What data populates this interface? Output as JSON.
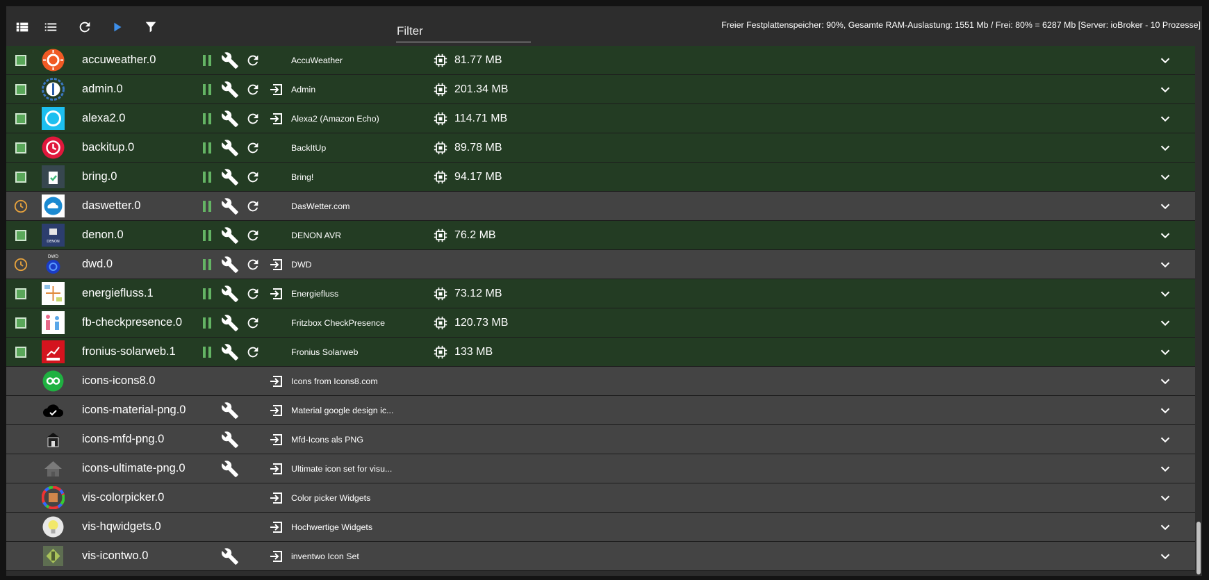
{
  "toolbar": {
    "buttons": [
      {
        "name": "tile-view-button",
        "icon": "view-module-icon"
      },
      {
        "name": "list-view-button",
        "icon": "view-list-icon"
      },
      {
        "name": "refresh-button",
        "icon": "refresh-icon"
      },
      {
        "name": "play-button",
        "icon": "play-icon"
      },
      {
        "name": "filter-button",
        "icon": "filter-icon"
      }
    ],
    "filter_placeholder": "Filter",
    "status": "Freier Festplattenspeicher: 90%, Gesamte RAM-Auslastung: 1551 Mb / Frei: 80% = 6287 Mb [Server: ioBroker - 10 Prozesse]"
  },
  "colors": {
    "running_row": "#233c23",
    "stopped_row": "#444444",
    "status_green": "#5aa75a",
    "schedule_orange": "#e8a33d",
    "action_green": "#64b464",
    "play_blue": "#3d8ee8"
  },
  "instances": [
    {
      "name": "accuweather.0",
      "title": "AccuWeather",
      "ram": "81.77 MB",
      "state": "running",
      "icon": "accuweather-icon",
      "pause": true,
      "settings": true,
      "restart": true,
      "open": false
    },
    {
      "name": "admin.0",
      "title": "Admin",
      "ram": "201.34 MB",
      "state": "running",
      "icon": "admin-icon",
      "pause": true,
      "settings": true,
      "restart": true,
      "open": true
    },
    {
      "name": "alexa2.0",
      "title": "Alexa2 (Amazon Echo)",
      "ram": "114.71 MB",
      "state": "running",
      "icon": "alexa-icon",
      "pause": true,
      "settings": true,
      "restart": true,
      "open": true
    },
    {
      "name": "backitup.0",
      "title": "BackItUp",
      "ram": "89.78 MB",
      "state": "running",
      "icon": "backitup-icon",
      "pause": true,
      "settings": true,
      "restart": true,
      "open": false
    },
    {
      "name": "bring.0",
      "title": "Bring!",
      "ram": "94.17 MB",
      "state": "running",
      "icon": "bring-icon",
      "pause": true,
      "settings": true,
      "restart": true,
      "open": false
    },
    {
      "name": "daswetter.0",
      "title": "DasWetter.com",
      "ram": "",
      "state": "scheduled",
      "icon": "daswetter-icon",
      "pause": true,
      "settings": true,
      "restart": true,
      "open": false
    },
    {
      "name": "denon.0",
      "title": "DENON AVR",
      "ram": "76.2 MB",
      "state": "running",
      "icon": "denon-icon",
      "pause": true,
      "settings": true,
      "restart": true,
      "open": false
    },
    {
      "name": "dwd.0",
      "title": "DWD",
      "ram": "",
      "state": "scheduled",
      "icon": "dwd-icon",
      "pause": true,
      "settings": true,
      "restart": true,
      "open": true
    },
    {
      "name": "energiefluss.1",
      "title": "Energiefluss",
      "ram": "73.12 MB",
      "state": "running",
      "icon": "energiefluss-icon",
      "pause": true,
      "settings": true,
      "restart": true,
      "open": true
    },
    {
      "name": "fb-checkpresence.0",
      "title": "Fritzbox CheckPresence",
      "ram": "120.73 MB",
      "state": "running",
      "icon": "fb-checkpresence-icon",
      "pause": true,
      "settings": true,
      "restart": true,
      "open": false
    },
    {
      "name": "fronius-solarweb.1",
      "title": "Fronius Solarweb",
      "ram": "133 MB",
      "state": "running",
      "icon": "fronius-icon",
      "pause": true,
      "settings": true,
      "restart": true,
      "open": false
    },
    {
      "name": "icons-icons8.0",
      "title": "Icons from Icons8.com",
      "ram": "",
      "state": "none",
      "icon": "icons8-icon",
      "pause": false,
      "settings": false,
      "restart": false,
      "open": true
    },
    {
      "name": "icons-material-png.0",
      "title": "Material google design ic...",
      "ram": "",
      "state": "none",
      "icon": "cloud-check-icon",
      "pause": false,
      "settings": true,
      "restart": false,
      "open": true
    },
    {
      "name": "icons-mfd-png.0",
      "title": "Mfd-Icons als PNG",
      "ram": "",
      "state": "none",
      "icon": "mfd-icon",
      "pause": false,
      "settings": true,
      "restart": false,
      "open": true
    },
    {
      "name": "icons-ultimate-png.0",
      "title": "Ultimate icon set for visu...",
      "ram": "",
      "state": "none",
      "icon": "house-icon",
      "pause": false,
      "settings": true,
      "restart": false,
      "open": true
    },
    {
      "name": "vis-colorpicker.0",
      "title": "Color picker Widgets",
      "ram": "",
      "state": "none",
      "icon": "colorpicker-icon",
      "pause": false,
      "settings": false,
      "restart": false,
      "open": true
    },
    {
      "name": "vis-hqwidgets.0",
      "title": "Hochwertige Widgets",
      "ram": "",
      "state": "none",
      "icon": "lightbulb-icon",
      "pause": false,
      "settings": false,
      "restart": false,
      "open": true
    },
    {
      "name": "vis-icontwo.0",
      "title": "inventwo Icon Set",
      "ram": "",
      "state": "none",
      "icon": "inventwo-icon",
      "pause": false,
      "settings": true,
      "restart": false,
      "open": true
    }
  ]
}
